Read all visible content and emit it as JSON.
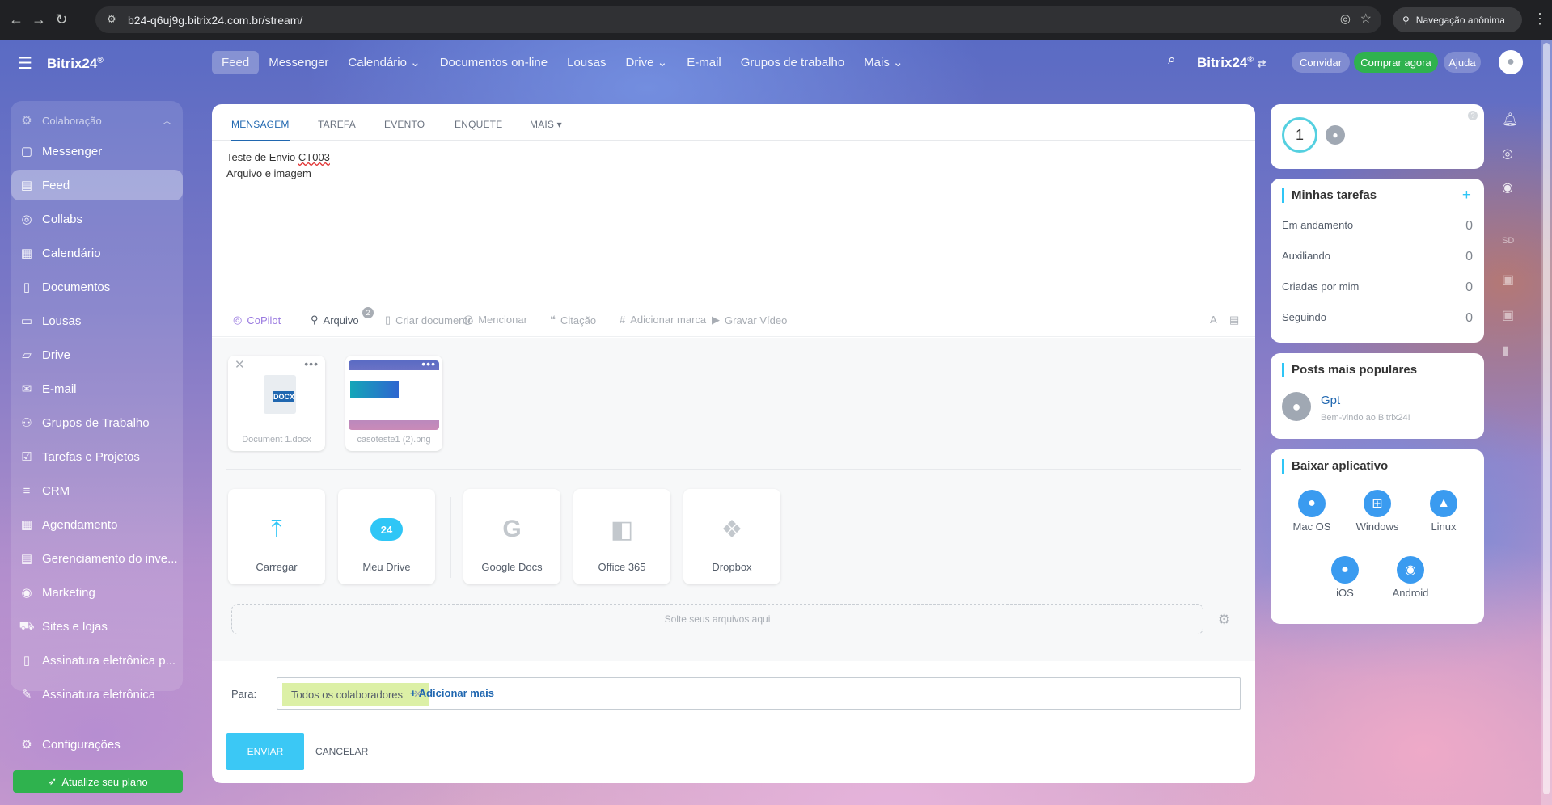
{
  "browser": {
    "url": "b24-q6uj9g.bitrix24.com.br/stream/",
    "incognito_label": "Navegação anônima"
  },
  "app": {
    "logo": "Bitrix24",
    "logo_mark": "®",
    "brand_right": "Bitrix24"
  },
  "sidebar": {
    "section": "Colaboração",
    "items": [
      {
        "label": "Messenger",
        "icon": "chat-icon"
      },
      {
        "label": "Feed",
        "icon": "feed-icon",
        "active": true
      },
      {
        "label": "Collabs",
        "icon": "collabs-icon"
      },
      {
        "label": "Calendário",
        "icon": "calendar-icon"
      },
      {
        "label": "Documentos",
        "icon": "document-icon"
      },
      {
        "label": "Lousas",
        "icon": "board-icon"
      },
      {
        "label": "Drive",
        "icon": "drive-icon"
      },
      {
        "label": "E-mail",
        "icon": "mail-icon"
      },
      {
        "label": "Grupos de Trabalho",
        "icon": "group-icon"
      },
      {
        "label": "Tarefas e Projetos",
        "icon": "tasks-icon"
      },
      {
        "label": "CRM",
        "icon": "crm-icon"
      },
      {
        "label": "Agendamento",
        "icon": "booking-icon"
      },
      {
        "label": "Gerenciamento do inve...",
        "icon": "inventory-icon"
      },
      {
        "label": "Marketing",
        "icon": "marketing-icon"
      },
      {
        "label": "Sites e lojas",
        "icon": "cart-icon"
      },
      {
        "label": "Assinatura eletrônica p...",
        "icon": "sign-icon"
      },
      {
        "label": "Assinatura eletrônica",
        "icon": "pen-icon"
      }
    ],
    "settings": "Configurações",
    "upgrade": "Atualize seu plano"
  },
  "topnav": {
    "items": [
      {
        "label": "Feed",
        "active": true
      },
      {
        "label": "Messenger"
      },
      {
        "label": "Calendário ⌄"
      },
      {
        "label": "Documentos on-line"
      },
      {
        "label": "Lousas"
      },
      {
        "label": "Drive ⌄"
      },
      {
        "label": "E-mail"
      },
      {
        "label": "Grupos de trabalho"
      },
      {
        "label": "Mais ⌄"
      }
    ],
    "invite": "Convidar",
    "buy": "Comprar agora",
    "help": "Ajuda"
  },
  "composer": {
    "tabs": [
      "MENSAGEM",
      "TAREFA",
      "EVENTO",
      "ENQUETE",
      "MAIS ▾"
    ],
    "text_line1_prefix": "Teste de Envio ",
    "text_line1_word": "CT003",
    "text_line2": "Arquivo e imagem",
    "toolbar": {
      "copilot": "CoPilot",
      "file": "Arquivo",
      "file_count": "2",
      "create_doc": "Criar documento",
      "mention": "Mencionar",
      "quote": "Citação",
      "tag": "Adicionar marca",
      "video": "Gravar Vídeo",
      "format": "A"
    },
    "files": [
      {
        "name": "Document 1.docx",
        "type": "DOCX"
      },
      {
        "name": "casoteste1 (2).png",
        "type": "image"
      }
    ],
    "sources": [
      {
        "label": "Carregar",
        "icon": "upload-icon"
      },
      {
        "label": "Meu Drive",
        "icon": "cloud-24-icon",
        "badge": "24"
      },
      {
        "label": "Google Docs",
        "icon": "google-icon"
      },
      {
        "label": "Office 365",
        "icon": "office-icon"
      },
      {
        "label": "Dropbox",
        "icon": "dropbox-icon"
      }
    ],
    "dropzone": "Solte seus arquivos aqui",
    "to_label": "Para:",
    "recipient": "Todos os colaboradores",
    "add_more": "+ Adicionar mais",
    "send": "ENVIAR",
    "cancel": "CANCELAR"
  },
  "right": {
    "counter": "1",
    "tasks_title": "Minhas tarefas",
    "tasks": [
      {
        "label": "Em andamento",
        "count": "0"
      },
      {
        "label": "Auxiliando",
        "count": "0"
      },
      {
        "label": "Criadas por mim",
        "count": "0"
      },
      {
        "label": "Seguindo",
        "count": "0"
      }
    ],
    "popular_title": "Posts mais populares",
    "popular_name": "Gpt",
    "popular_sub": "Bem-vindo ao Bitrix24!",
    "apps_title": "Baixar aplicativo",
    "apps": [
      "Mac OS",
      "Windows",
      "Linux",
      "iOS",
      "Android"
    ],
    "rail_initials": "SD"
  }
}
